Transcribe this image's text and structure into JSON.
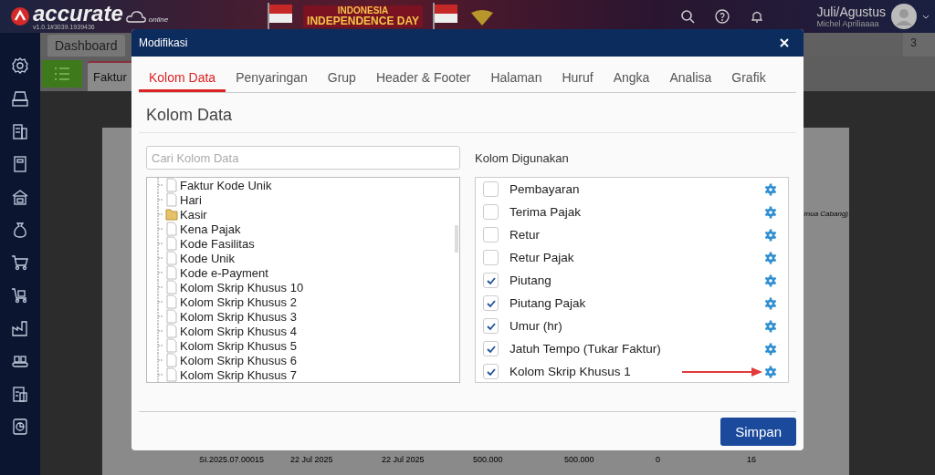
{
  "header": {
    "logo": "accurate",
    "logo_sub": "online",
    "version": "v1.0.1#3039.1939436",
    "banner": [
      "INDONESIA",
      "INDEPENDENCE DAY"
    ],
    "period": "Juli/Agustus",
    "user": "Michel Apriliaaaa"
  },
  "app_tabs": [
    {
      "label": "Dashboard",
      "selected": false
    },
    {
      "label": "Faktur",
      "selected": true
    }
  ],
  "page_select": "3",
  "report": {
    "note": "mua Cabang)",
    "rows": [
      [
        "SI.2025.07.00015",
        "22 Jul 2025",
        "22 Jul 2025",
        "500.000",
        "500.000",
        "0",
        "16"
      ]
    ]
  },
  "modal": {
    "title": "Modifikasi",
    "tabs": [
      {
        "label": "Kolom Data",
        "selected": true
      },
      {
        "label": "Penyaringan",
        "selected": false
      },
      {
        "label": "Grup",
        "selected": false
      },
      {
        "label": "Header & Footer",
        "selected": false
      },
      {
        "label": "Halaman",
        "selected": false
      },
      {
        "label": "Huruf",
        "selected": false
      },
      {
        "label": "Angka",
        "selected": false
      },
      {
        "label": "Analisa",
        "selected": false
      },
      {
        "label": "Grafik",
        "selected": false
      }
    ],
    "heading": "Kolom Data",
    "search": {
      "placeholder": "Cari Kolom Data"
    },
    "tree": [
      {
        "label": "Faktur Kode Unik",
        "kind": "file"
      },
      {
        "label": "Hari",
        "kind": "file"
      },
      {
        "label": "Kasir",
        "kind": "folder"
      },
      {
        "label": "Kena Pajak",
        "kind": "file"
      },
      {
        "label": "Kode Fasilitas",
        "kind": "file"
      },
      {
        "label": "Kode Unik",
        "kind": "file"
      },
      {
        "label": "Kode e-Payment",
        "kind": "file"
      },
      {
        "label": "Kolom Skrip Khusus 10",
        "kind": "file"
      },
      {
        "label": "Kolom Skrip Khusus 2",
        "kind": "file"
      },
      {
        "label": "Kolom Skrip Khusus 3",
        "kind": "file"
      },
      {
        "label": "Kolom Skrip Khusus 4",
        "kind": "file"
      },
      {
        "label": "Kolom Skrip Khusus 5",
        "kind": "file"
      },
      {
        "label": "Kolom Skrip Khusus 6",
        "kind": "file"
      },
      {
        "label": "Kolom Skrip Khusus 7",
        "kind": "file"
      }
    ],
    "used_label": "Kolom Digunakan",
    "used_columns": [
      {
        "label": "Pembayaran",
        "checked": false
      },
      {
        "label": "Terima Pajak",
        "checked": false
      },
      {
        "label": "Retur",
        "checked": false
      },
      {
        "label": "Retur Pajak",
        "checked": false
      },
      {
        "label": "Piutang",
        "checked": true
      },
      {
        "label": "Piutang Pajak",
        "checked": true
      },
      {
        "label": "Umur (hr)",
        "checked": true
      },
      {
        "label": "Jatuh Tempo (Tukar Faktur)",
        "checked": true
      },
      {
        "label": "Kolom Skrip Khusus 1",
        "checked": true,
        "arrow": true
      }
    ],
    "save_button": "Simpan"
  }
}
